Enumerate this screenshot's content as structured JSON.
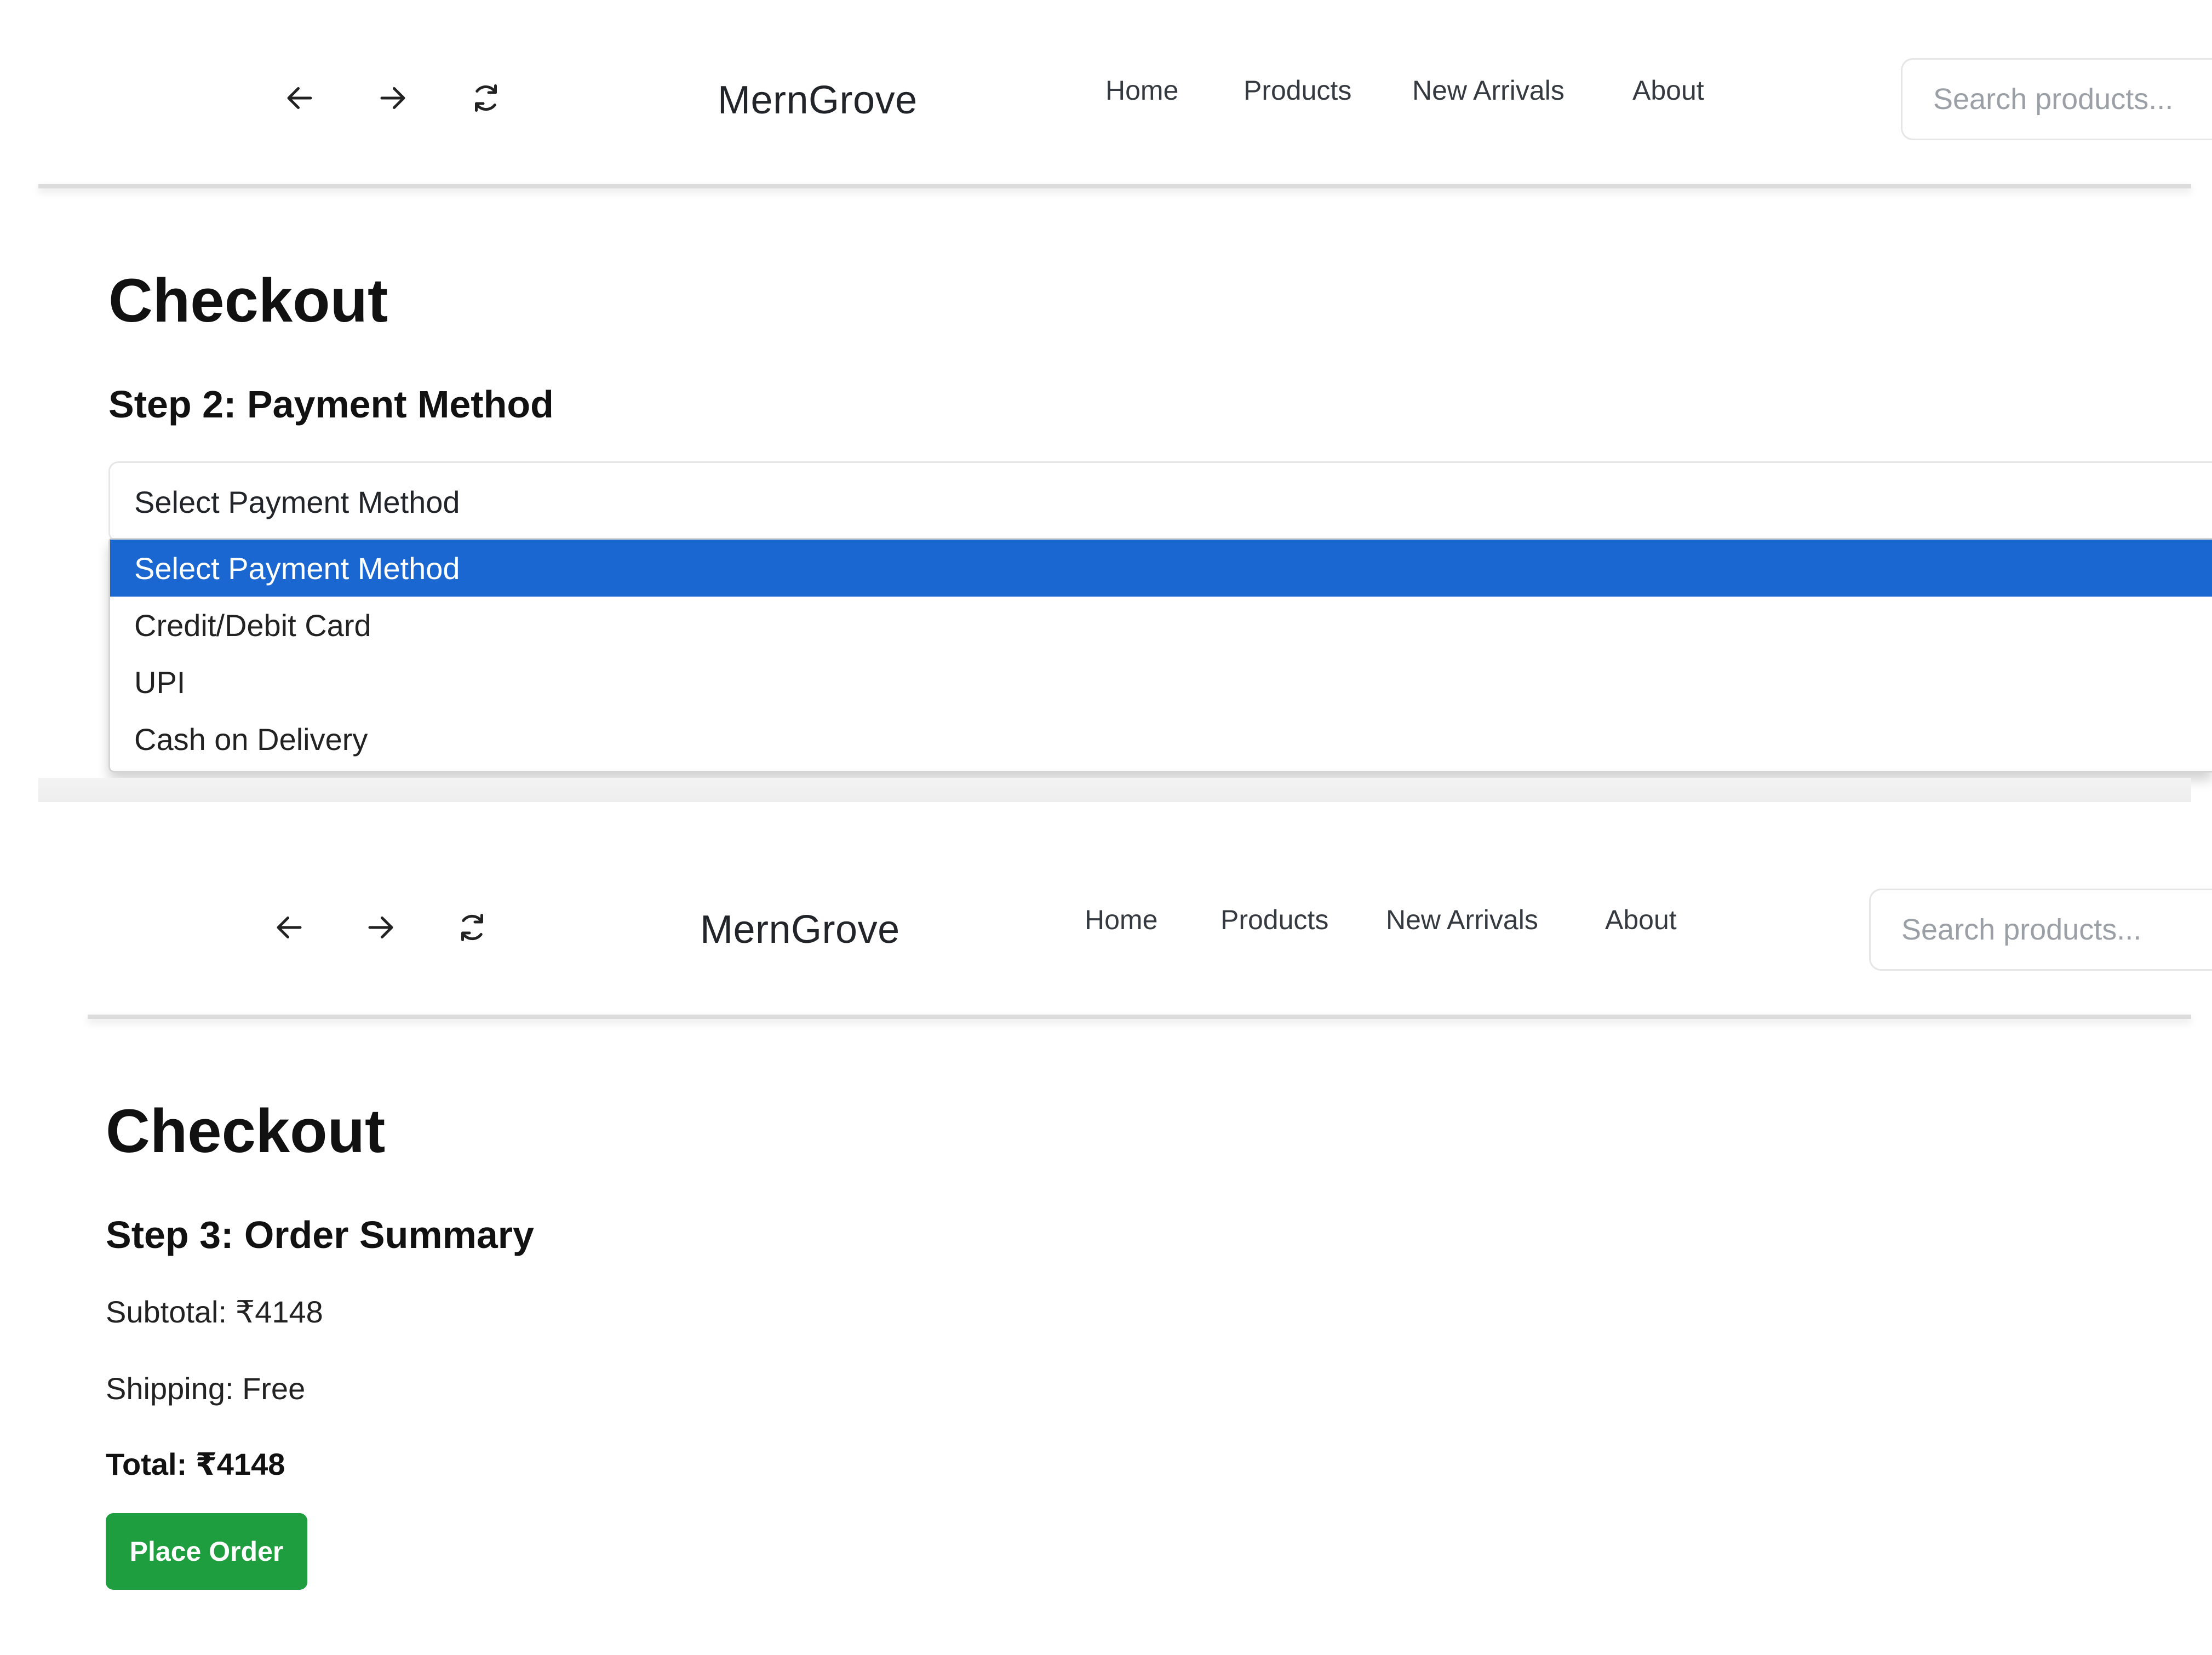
{
  "app": {
    "brand": "MernGrove"
  },
  "nav": {
    "links": [
      "Home",
      "Products",
      "New Arrivals",
      "About"
    ],
    "search_placeholder": "Search products..."
  },
  "icons": {
    "back": "arrow-left-icon",
    "forward": "arrow-right-icon",
    "reload": "reload-icon"
  },
  "screen1": {
    "title": "Checkout",
    "step": "Step 2: Payment Method",
    "select_value": "Select Payment Method",
    "options": [
      "Select Payment Method",
      "Credit/Debit Card",
      "UPI",
      "Cash on Delivery"
    ],
    "selected_option": "Select Payment Method"
  },
  "screen2": {
    "title": "Checkout",
    "step": "Step 3: Order Summary",
    "subtotal": "Subtotal: ₹4148",
    "shipping": "Shipping: Free",
    "total": "Total: ₹4148",
    "place_order": "Place Order"
  },
  "colors": {
    "selected_option_bg": "#1a67d2",
    "place_order_bg": "#1e9e3e"
  }
}
